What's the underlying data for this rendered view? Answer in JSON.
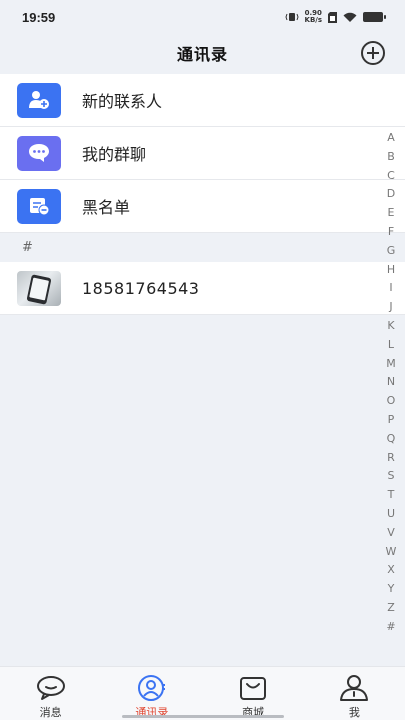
{
  "status_bar": {
    "time": "19:59",
    "net_speed_value": "0.90",
    "net_speed_unit": "KB/s"
  },
  "header": {
    "title": "通讯录"
  },
  "menu": [
    {
      "label": "新的联系人",
      "icon": "add-contact-icon",
      "color": "#3b73f2"
    },
    {
      "label": "我的群聊",
      "icon": "chat-bubble-icon",
      "color": "#6a6ff0"
    },
    {
      "label": "黑名单",
      "icon": "blacklist-icon",
      "color": "#3b73f2"
    }
  ],
  "section_header": "#",
  "contacts": [
    {
      "name": "18581764543"
    }
  ],
  "index_letters": [
    "A",
    "B",
    "C",
    "D",
    "E",
    "F",
    "G",
    "H",
    "I",
    "J",
    "K",
    "L",
    "M",
    "N",
    "O",
    "P",
    "Q",
    "R",
    "S",
    "T",
    "U",
    "V",
    "W",
    "X",
    "Y",
    "Z",
    "#"
  ],
  "tabs": [
    {
      "label": "消息",
      "icon": "message-icon",
      "active": false
    },
    {
      "label": "通讯录",
      "icon": "contacts-icon",
      "active": true
    },
    {
      "label": "商城",
      "icon": "shopping-bag-icon",
      "active": false
    },
    {
      "label": "我",
      "icon": "profile-icon",
      "active": false
    }
  ],
  "colors": {
    "accent": "#3b73f2",
    "active_tab": "#e0452f",
    "background": "#eef1f6"
  }
}
